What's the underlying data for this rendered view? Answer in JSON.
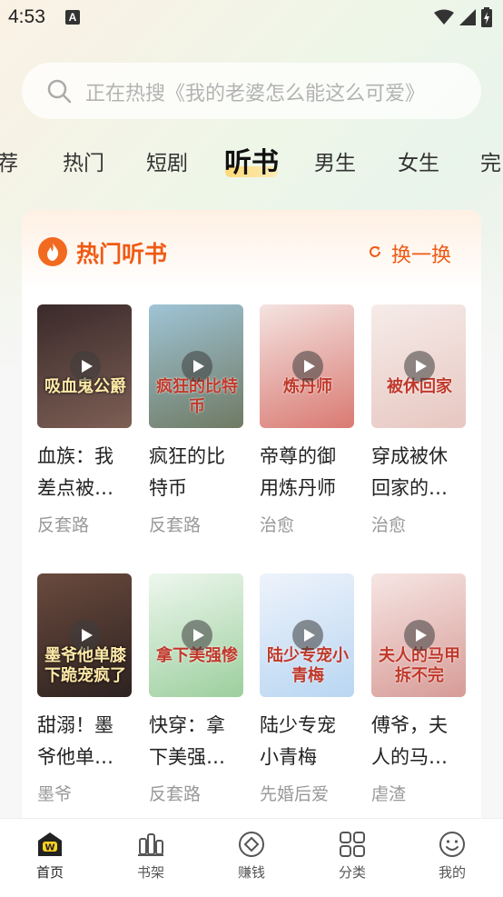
{
  "status_bar": {
    "time": "4:53",
    "notification": "A"
  },
  "search": {
    "placeholder": "正在热搜《我的老婆怎么能这么可爱》"
  },
  "tabs": [
    {
      "label": "荐"
    },
    {
      "label": "热门"
    },
    {
      "label": "短剧"
    },
    {
      "label": "听书",
      "active": true
    },
    {
      "label": "男生"
    },
    {
      "label": "女生"
    },
    {
      "label": "完"
    }
  ],
  "section": {
    "title": "热门听书",
    "refresh_label": "换一换",
    "accent_color": "#f05a14"
  },
  "books": [
    {
      "title_line1": "血族：我",
      "title_line2": "差点被…",
      "tag": "反套路",
      "cover_text": "吸血鬼公爵",
      "cover_colors": [
        "#3a2a2a",
        "#7d5f55"
      ]
    },
    {
      "title_line1": "疯狂的比",
      "title_line2": "特币",
      "tag": "反套路",
      "cover_text": "疯狂的比特币",
      "cover_colors": [
        "#9fc4d6",
        "#6f7a63"
      ]
    },
    {
      "title_line1": "帝尊的御",
      "title_line2": "用炼丹师",
      "tag": "治愈",
      "cover_text": "炼丹师",
      "cover_colors": [
        "#f4e3e1",
        "#d97a72"
      ]
    },
    {
      "title_line1": "穿成被休",
      "title_line2": "回家的…",
      "tag": "治愈",
      "cover_text": "被休回家",
      "cover_colors": [
        "#f6ece9",
        "#e7c7c1"
      ]
    },
    {
      "title_line1": "甜溺！墨",
      "title_line2": "爷他单…",
      "tag": "墨爷",
      "cover_text": "墨爷他单膝下跪宠疯了",
      "cover_colors": [
        "#6a4a3e",
        "#2d2220"
      ]
    },
    {
      "title_line1": "快穿：拿",
      "title_line2": "下美强…",
      "tag": "反套路",
      "cover_text": "拿下美强惨",
      "cover_colors": [
        "#eef7ee",
        "#9ccf9e"
      ]
    },
    {
      "title_line1": "陆少专宠",
      "title_line2": "小青梅",
      "tag": "先婚后爱",
      "cover_text": "陆少专宠小青梅",
      "cover_colors": [
        "#eef3fb",
        "#b9d6f2"
      ]
    },
    {
      "title_line1": "傅爷，夫",
      "title_line2": "人的马…",
      "tag": "虐渣",
      "cover_text": "夫人的马甲拆不完",
      "cover_colors": [
        "#f6e6e4",
        "#d79b96"
      ]
    }
  ],
  "bottom_nav": [
    {
      "label": "首页",
      "icon": "home-icon",
      "active": true
    },
    {
      "label": "书架",
      "icon": "bookshelf-icon"
    },
    {
      "label": "赚钱",
      "icon": "earn-icon"
    },
    {
      "label": "分类",
      "icon": "category-icon"
    },
    {
      "label": "我的",
      "icon": "profile-icon"
    }
  ]
}
